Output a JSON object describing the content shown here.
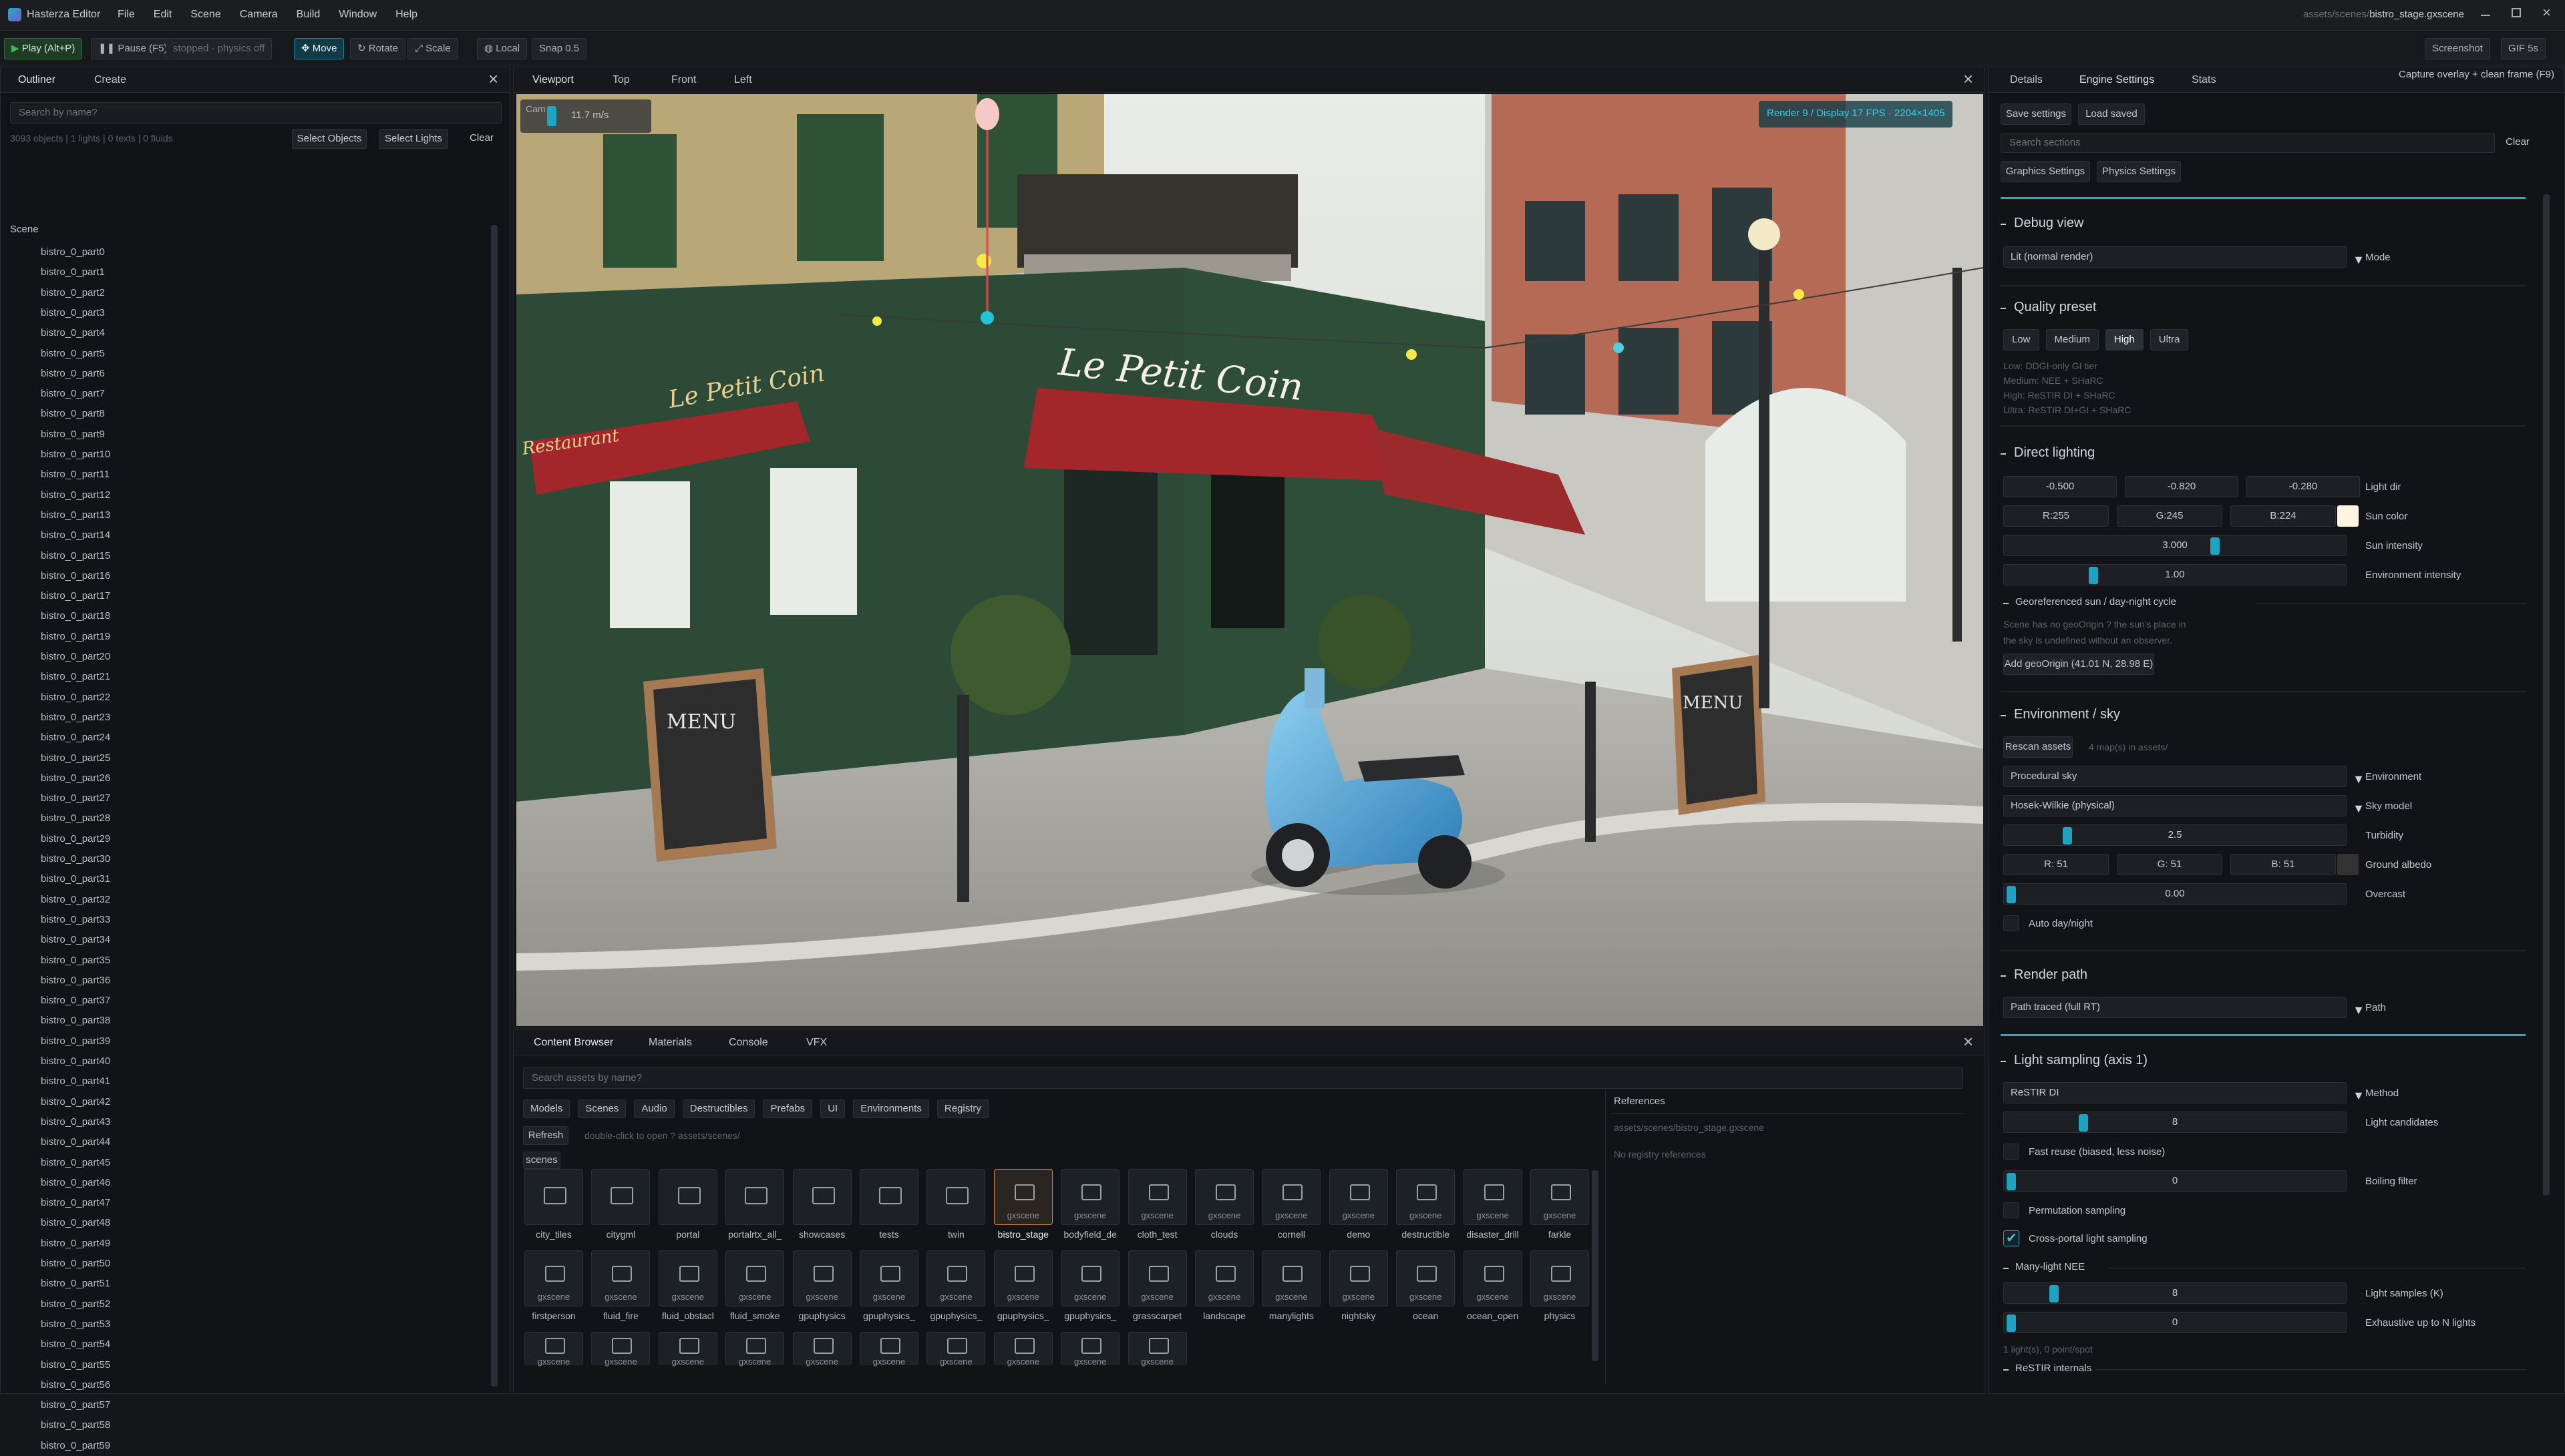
{
  "app": {
    "title": "Hasterza Editor",
    "scene_path_prefix": "assets/scenes/",
    "scene_path_file": "bistro_stage.gxscene"
  },
  "menu": [
    "File",
    "Edit",
    "Scene",
    "Camera",
    "Build",
    "Window",
    "Help"
  ],
  "toolbar": {
    "play": "Play (Alt+P)",
    "pause": "Pause (F5)",
    "physics_status": "stopped · physics off",
    "move": "Move",
    "rotate": "Rotate",
    "scale": "Scale",
    "local": "Local",
    "snap": "Snap 0.5",
    "screenshot": "Screenshot",
    "gif": "GIF 5s"
  },
  "capture_hint": "Capture overlay + clean frame (F9)",
  "outliner": {
    "tabs": [
      "Outliner",
      "Create"
    ],
    "search_placeholder": "Search by name?",
    "stats": "3093 objects | 1 lights | 0 texts | 0 fluids",
    "select_objects": "Select Objects",
    "select_lights": "Select Lights",
    "clear": "Clear",
    "root": "Scene",
    "items": [
      "bistro_0_part0",
      "bistro_0_part1",
      "bistro_0_part2",
      "bistro_0_part3",
      "bistro_0_part4",
      "bistro_0_part5",
      "bistro_0_part6",
      "bistro_0_part7",
      "bistro_0_part8",
      "bistro_0_part9",
      "bistro_0_part10",
      "bistro_0_part11",
      "bistro_0_part12",
      "bistro_0_part13",
      "bistro_0_part14",
      "bistro_0_part15",
      "bistro_0_part16",
      "bistro_0_part17",
      "bistro_0_part18",
      "bistro_0_part19",
      "bistro_0_part20",
      "bistro_0_part21",
      "bistro_0_part22",
      "bistro_0_part23",
      "bistro_0_part24",
      "bistro_0_part25",
      "bistro_0_part26",
      "bistro_0_part27",
      "bistro_0_part28",
      "bistro_0_part29",
      "bistro_0_part30",
      "bistro_0_part31",
      "bistro_0_part32",
      "bistro_0_part33",
      "bistro_0_part34",
      "bistro_0_part35",
      "bistro_0_part36",
      "bistro_0_part37",
      "bistro_0_part38",
      "bistro_0_part39",
      "bistro_0_part40",
      "bistro_0_part41",
      "bistro_0_part42",
      "bistro_0_part43",
      "bistro_0_part44",
      "bistro_0_part45",
      "bistro_0_part46",
      "bistro_0_part47",
      "bistro_0_part48",
      "bistro_0_part49",
      "bistro_0_part50",
      "bistro_0_part51",
      "bistro_0_part52",
      "bistro_0_part53",
      "bistro_0_part54",
      "bistro_0_part55",
      "bistro_0_part56",
      "bistro_0_part57",
      "bistro_0_part58",
      "bistro_0_part59"
    ]
  },
  "viewport": {
    "tabs": [
      "Viewport",
      "Top",
      "Front",
      "Left"
    ],
    "cam_label": "Cam",
    "speed": "11.7 m/s",
    "render_stats": "Render 9 / Display 17 FPS · 2204×1405",
    "sign_main": "Le Petit Coin",
    "sign_side": "Le Petit Coin",
    "sign_restaurant": "Restaurant",
    "menu_board": "MENU"
  },
  "content": {
    "tabs": [
      "Content Browser",
      "Materials",
      "Console",
      "VFX"
    ],
    "search_placeholder": "Search assets by name?",
    "categories": [
      "Models",
      "Scenes",
      "Audio",
      "Destructibles",
      "Prefabs",
      "UI",
      "Environments",
      "Registry"
    ],
    "refresh": "Refresh",
    "hint": "double-click to open ? assets/scenes/",
    "folder": "scenes",
    "references_title": "References",
    "references_path": "assets/scenes/bistro_stage.gxscene",
    "no_refs": "No registry references",
    "row1": [
      {
        "name": "city_tiles",
        "type": "folder"
      },
      {
        "name": "citygml",
        "type": "folder"
      },
      {
        "name": "portal",
        "type": "folder"
      },
      {
        "name": "portalrtx_all_",
        "type": "folder"
      },
      {
        "name": "showcases",
        "type": "folder"
      },
      {
        "name": "tests",
        "type": "folder"
      },
      {
        "name": "twin",
        "type": "folder"
      },
      {
        "name": "bistro_stage",
        "type": "gxscene"
      },
      {
        "name": "bodyfield_de",
        "type": "gxscene"
      },
      {
        "name": "cloth_test",
        "type": "gxscene"
      },
      {
        "name": "clouds",
        "type": "gxscene"
      },
      {
        "name": "cornell",
        "type": "gxscene"
      },
      {
        "name": "demo",
        "type": "gxscene"
      },
      {
        "name": "destructible",
        "type": "gxscene"
      },
      {
        "name": "disaster_drill",
        "type": "gxscene"
      },
      {
        "name": "farkle",
        "type": "gxscene"
      }
    ],
    "row2": [
      {
        "name": "firstperson",
        "type": "gxscene"
      },
      {
        "name": "fluid_fire",
        "type": "gxscene"
      },
      {
        "name": "fluid_obstacl",
        "type": "gxscene"
      },
      {
        "name": "fluid_smoke",
        "type": "gxscene"
      },
      {
        "name": "gpuphysics",
        "type": "gxscene"
      },
      {
        "name": "gpuphysics_",
        "type": "gxscene"
      },
      {
        "name": "gpuphysics_",
        "type": "gxscene"
      },
      {
        "name": "gpuphysics_",
        "type": "gxscene"
      },
      {
        "name": "gpuphysics_",
        "type": "gxscene"
      },
      {
        "name": "grasscarpet",
        "type": "gxscene"
      },
      {
        "name": "landscape",
        "type": "gxscene"
      },
      {
        "name": "manylights",
        "type": "gxscene"
      },
      {
        "name": "nightsky",
        "type": "gxscene"
      },
      {
        "name": "ocean",
        "type": "gxscene"
      },
      {
        "name": "ocean_open",
        "type": "gxscene"
      },
      {
        "name": "physics",
        "type": "gxscene"
      }
    ],
    "row3_tag": "gxscene"
  },
  "right": {
    "tabs": [
      "Details",
      "Engine Settings",
      "Stats"
    ],
    "save_settings": "Save settings",
    "load_saved": "Load saved",
    "search_placeholder": "Search sections",
    "clear": "Clear",
    "sub_tabs": [
      "Graphics Settings",
      "Physics Settings"
    ],
    "debug_view": {
      "title": "Debug view",
      "mode_value": "Lit (normal render)",
      "mode_label": "Mode"
    },
    "quality": {
      "title": "Quality preset",
      "options": [
        "Low",
        "Medium",
        "High",
        "Ultra"
      ],
      "active": "High",
      "notes": [
        "Low: DDGI-only GI tier",
        "Medium: NEE + SHaRC",
        "High: ReSTIR DI + SHaRC",
        "Ultra: ReSTIR DI+GI + SHaRC"
      ]
    },
    "direct": {
      "title": "Direct lighting",
      "light_dir": [
        "-0.500",
        "-0.820",
        "-0.280"
      ],
      "light_dir_label": "Light dir",
      "sun_color": [
        "R:255",
        "G:245",
        "B:224"
      ],
      "sun_color_label": "Sun color",
      "sun_color_hex": "#fff5e0",
      "sun_intensity": "3.000",
      "sun_intensity_norm": 0.62,
      "sun_intensity_label": "Sun intensity",
      "env_intensity": "1.00",
      "env_intensity_norm": 0.25,
      "env_intensity_label": "Environment intensity",
      "geo_title": "Georeferenced sun / day-night cycle",
      "geo_note_1": "Scene has no geoOrigin ? the sun's place in",
      "geo_note_2": "the sky is undefined without an observer.",
      "add_geo": "Add geoOrigin (41.01 N, 28.98 E)"
    },
    "env": {
      "title": "Environment / sky",
      "rescan": "Rescan assets",
      "maps_note": "4 map(s) in assets/",
      "environment_value": "Procedural sky",
      "environment_label": "Environment",
      "sky_model_value": "Hosek-Wilkie (physical)",
      "sky_model_label": "Sky model",
      "turbidity": "2.5",
      "turbidity_norm": 0.17,
      "turbidity_label": "Turbidity",
      "albedo": [
        "R: 51",
        "G: 51",
        "B: 51"
      ],
      "albedo_label": "Ground albedo",
      "albedo_hex": "#333333",
      "overcast": "0.00",
      "overcast_norm": 0.0,
      "overcast_label": "Overcast",
      "auto_day": "Auto day/night"
    },
    "render_path": {
      "title": "Render path",
      "value": "Path traced (full RT)",
      "label": "Path"
    },
    "sampling": {
      "title": "Light sampling (axis 1)",
      "method_value": "ReSTIR DI",
      "method_label": "Method",
      "candidates": "8",
      "candidates_norm": 0.22,
      "candidates_label": "Light candidates",
      "fast_reuse": "Fast reuse (biased, less noise)",
      "boiling": "0",
      "boiling_norm": 0.0,
      "boiling_label": "Boiling filter",
      "permutation": "Permutation sampling",
      "cross_portal": "Cross-portal light sampling",
      "many_light": "Many-light NEE",
      "light_samples": "8",
      "light_samples_norm": 0.13,
      "light_samples_label": "Light samples (K)",
      "exhaustive": "0",
      "exhaustive_norm": 0.0,
      "exhaustive_label": "Exhaustive up to N lights",
      "footer": "1 light(s), 0 point/spot",
      "restir": "ReSTIR internals"
    }
  },
  "colors": {
    "accent": "#1fa3c2",
    "play_green": "#3fb950"
  }
}
